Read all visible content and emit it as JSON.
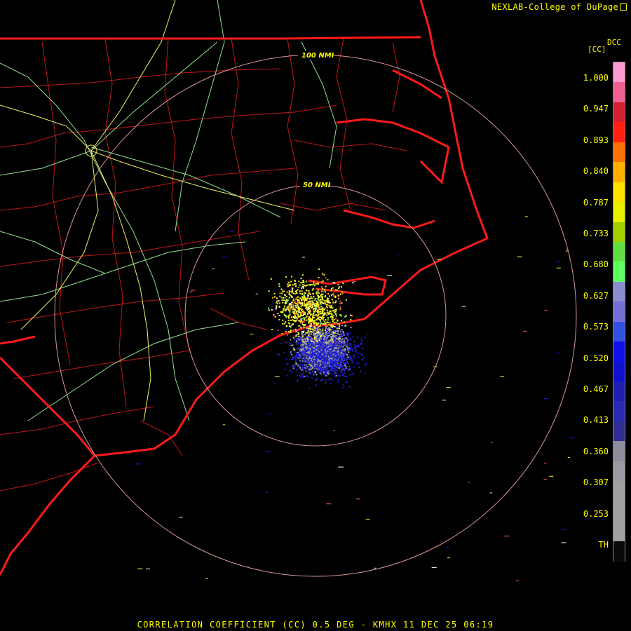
{
  "credit": "NEXLAB-College of DuPage",
  "colorbar": {
    "product_code": "DCC",
    "unit": "[CC]",
    "ticks": [
      "1.000",
      "0.947",
      "0.893",
      "0.840",
      "0.787",
      "0.733",
      "0.680",
      "0.627",
      "0.573",
      "0.520",
      "0.467",
      "0.413",
      "0.360",
      "0.307",
      "0.253",
      "TH"
    ],
    "colors": [
      "#ff9ad0",
      "#f06090",
      "#d22030",
      "#ff2010",
      "#ff7000",
      "#ffb000",
      "#ffe000",
      "#e8f000",
      "#a0d000",
      "#60e040",
      "#60ff60",
      "#8c8cd0",
      "#7070d8",
      "#3050e0",
      "#1010e8",
      "#1010d0",
      "#2020b0",
      "#2a2ab0",
      "#2e2e90",
      "#8c8c9c",
      "#9a9aa0",
      "#a0a0a0",
      "#a0a0a0",
      "#a0a0a0",
      "#0a0a0a"
    ]
  },
  "range_rings": [
    "100 NMI",
    "50 NMI"
  ],
  "map": {
    "state_border_color": "#ff1a1a",
    "county_color": "#c01818",
    "highway_interstate_color": "#f0f060",
    "highway_color": "#90e090",
    "ring_color": "#d89898"
  },
  "title": "CORRELATION COEFFICIENT (CC) 0.5 DEG - KMHX 11 DEC 25 06:19"
}
